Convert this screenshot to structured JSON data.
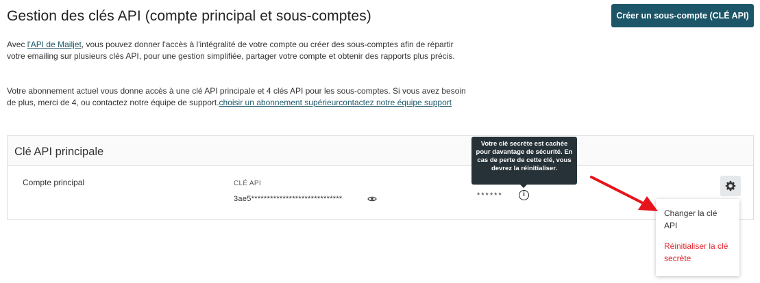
{
  "header": {
    "title": "Gestion des clés API (compte principal et sous-comptes)",
    "create_button": "Créer un sous-compte (CLÉ API)"
  },
  "intro": {
    "p1_prefix": "Avec ",
    "p1_link": "l'API de Mailjet",
    "p1_rest": ", vous pouvez donner l'accès à l'intégralité de votre compte ou créer des sous-comptes afin de répartir votre emailing sur plusieurs clés API, pour une gestion simplifiée, partager votre compte et obtenir des rapports plus précis.",
    "p2_text": "Votre abonnement actuel vous donne accès à une clé API principale et 4 clés API pour les sous-comptes. Si vous avez besoin de plus, merci de 4, ou contactez notre équipe de support.",
    "p2_link": "choisir un abonnement supérieurcontactez notre équipe support"
  },
  "card": {
    "title": "Clé API principale",
    "account_label": "Compte principal",
    "api_key_label": "CLÉ API",
    "api_key_value": "3ae5*****************************",
    "secret_mask": "******",
    "info_glyph": "i"
  },
  "tooltip": {
    "text": "Votre clé secrète est cachée pour davantage de sécurité. En cas de perte de cette clé, vous devrez la réinitialiser."
  },
  "menu": {
    "change_key": "Changer la clé API",
    "reset_secret": "Réinitialiser la clé secrète"
  },
  "icons": {
    "eye": "eye-icon",
    "info": "info-icon",
    "gear": "gear-icon"
  },
  "colors": {
    "primary": "#1c5668",
    "danger": "#e3262b",
    "tooltip_bg": "#263238",
    "annotation_arrow": "#e8141b"
  }
}
